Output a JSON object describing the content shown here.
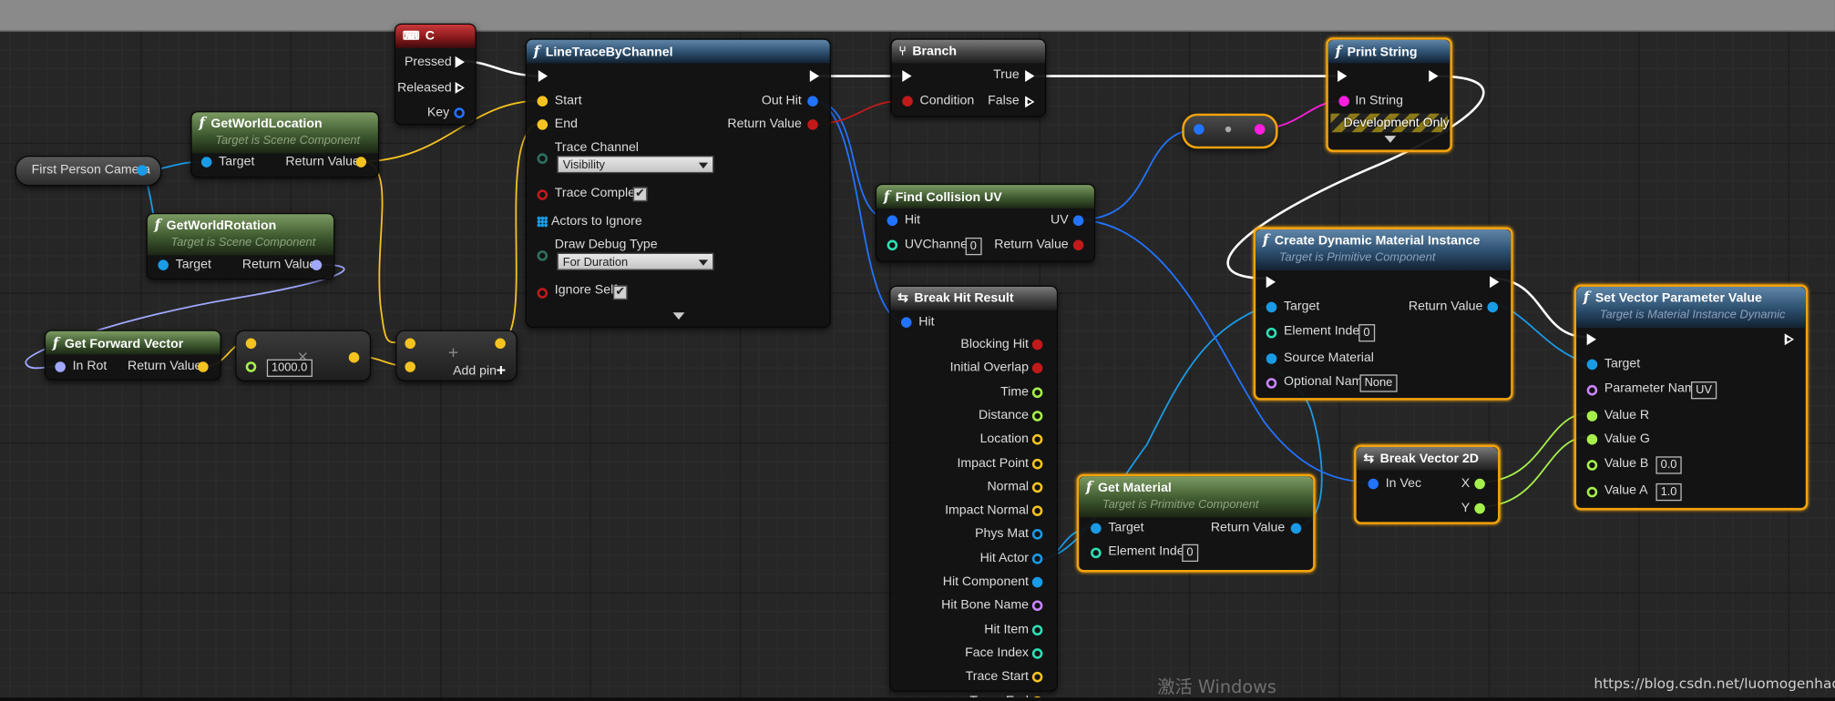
{
  "watermarks": {
    "windows": "激活 Windows",
    "url": "https://blog.csdn.net/luomogenhaoqi"
  },
  "colors": {
    "exec": "#ffffff",
    "vector": "#f5c320",
    "object": "#1a9be6",
    "boolean": "#c11a1a",
    "string": "#ff1ee0",
    "name": "#c985ff",
    "integer": "#2ee0b4",
    "float": "#a6f04c",
    "struct": "#2273ff",
    "rotator": "#a0a8ff",
    "material_highlight": "#f2a20d"
  },
  "nodes": {
    "first_person_camera": {
      "label": "First Person Camera"
    },
    "get_world_location": {
      "title": "GetWorldLocation",
      "subtitle": "Target is Scene Component",
      "target": "Target",
      "return_value": "Return Value"
    },
    "get_world_rotation": {
      "title": "GetWorldRotation",
      "subtitle": "Target is Scene Component",
      "target": "Target",
      "return_value": "Return Value"
    },
    "get_forward_vector": {
      "title": "Get Forward Vector",
      "in_rot": "In Rot",
      "return_value": "Return Value"
    },
    "multiply": {
      "symbol": "×",
      "value": "1000.0"
    },
    "add": {
      "symbol": "+",
      "add_pin": "Add pin",
      "add_pin_icon": "+"
    },
    "key_c": {
      "title": "C",
      "pressed": "Pressed",
      "released": "Released",
      "key": "Key"
    },
    "line_trace": {
      "title": "LineTraceByChannel",
      "start": "Start",
      "end": "End",
      "out_hit": "Out Hit",
      "return_value": "Return Value",
      "trace_channel": "Trace Channel",
      "trace_channel_value": "Visibility",
      "trace_complex": "Trace Complex",
      "actors_to_ignore": "Actors to Ignore",
      "draw_debug_type": "Draw Debug Type",
      "draw_debug_value": "For Duration",
      "ignore_self": "Ignore Self"
    },
    "branch": {
      "title": "Branch",
      "condition": "Condition",
      "true": "True",
      "false": "False"
    },
    "find_collision_uv": {
      "title": "Find Collision UV",
      "hit": "Hit",
      "uv": "UV",
      "uv_channel": "UVChannel",
      "uv_channel_value": "0",
      "return_value": "Return Value"
    },
    "break_hit_result": {
      "title": "Break Hit Result",
      "hit": "Hit",
      "outputs": [
        "Blocking Hit",
        "Initial Overlap",
        "Time",
        "Distance",
        "Location",
        "Impact Point",
        "Normal",
        "Impact Normal",
        "Phys Mat",
        "Hit Actor",
        "Hit Component",
        "Hit Bone Name",
        "Hit Item",
        "Face Index",
        "Trace Start",
        "Trace End"
      ]
    },
    "print_string": {
      "title": "Print String",
      "in_string": "In String",
      "dev_only": "Development Only"
    },
    "create_dmi": {
      "title": "Create Dynamic Material Instance",
      "subtitle": "Target is Primitive Component",
      "target": "Target",
      "return_value": "Return Value",
      "element_index": "Element Index",
      "element_index_value": "0",
      "source_material": "Source Material",
      "optional_name": "Optional Name",
      "optional_name_value": "None"
    },
    "get_material": {
      "title": "Get Material",
      "subtitle": "Target is Primitive Component",
      "target": "Target",
      "return_value": "Return Value",
      "element_index": "Element Index",
      "element_index_value": "0"
    },
    "break_vector_2d": {
      "title": "Break Vector 2D",
      "in_vec": "In Vec",
      "x": "X",
      "y": "Y"
    },
    "set_vector_param": {
      "title": "Set Vector Parameter Value",
      "subtitle": "Target is Material Instance Dynamic",
      "target": "Target",
      "parameter_name": "Parameter Name",
      "parameter_name_value": "UV",
      "value_r": "Value R",
      "value_g": "Value G",
      "value_b": "Value B",
      "value_b_value": "0.0",
      "value_a": "Value A",
      "value_a_value": "1.0"
    }
  }
}
